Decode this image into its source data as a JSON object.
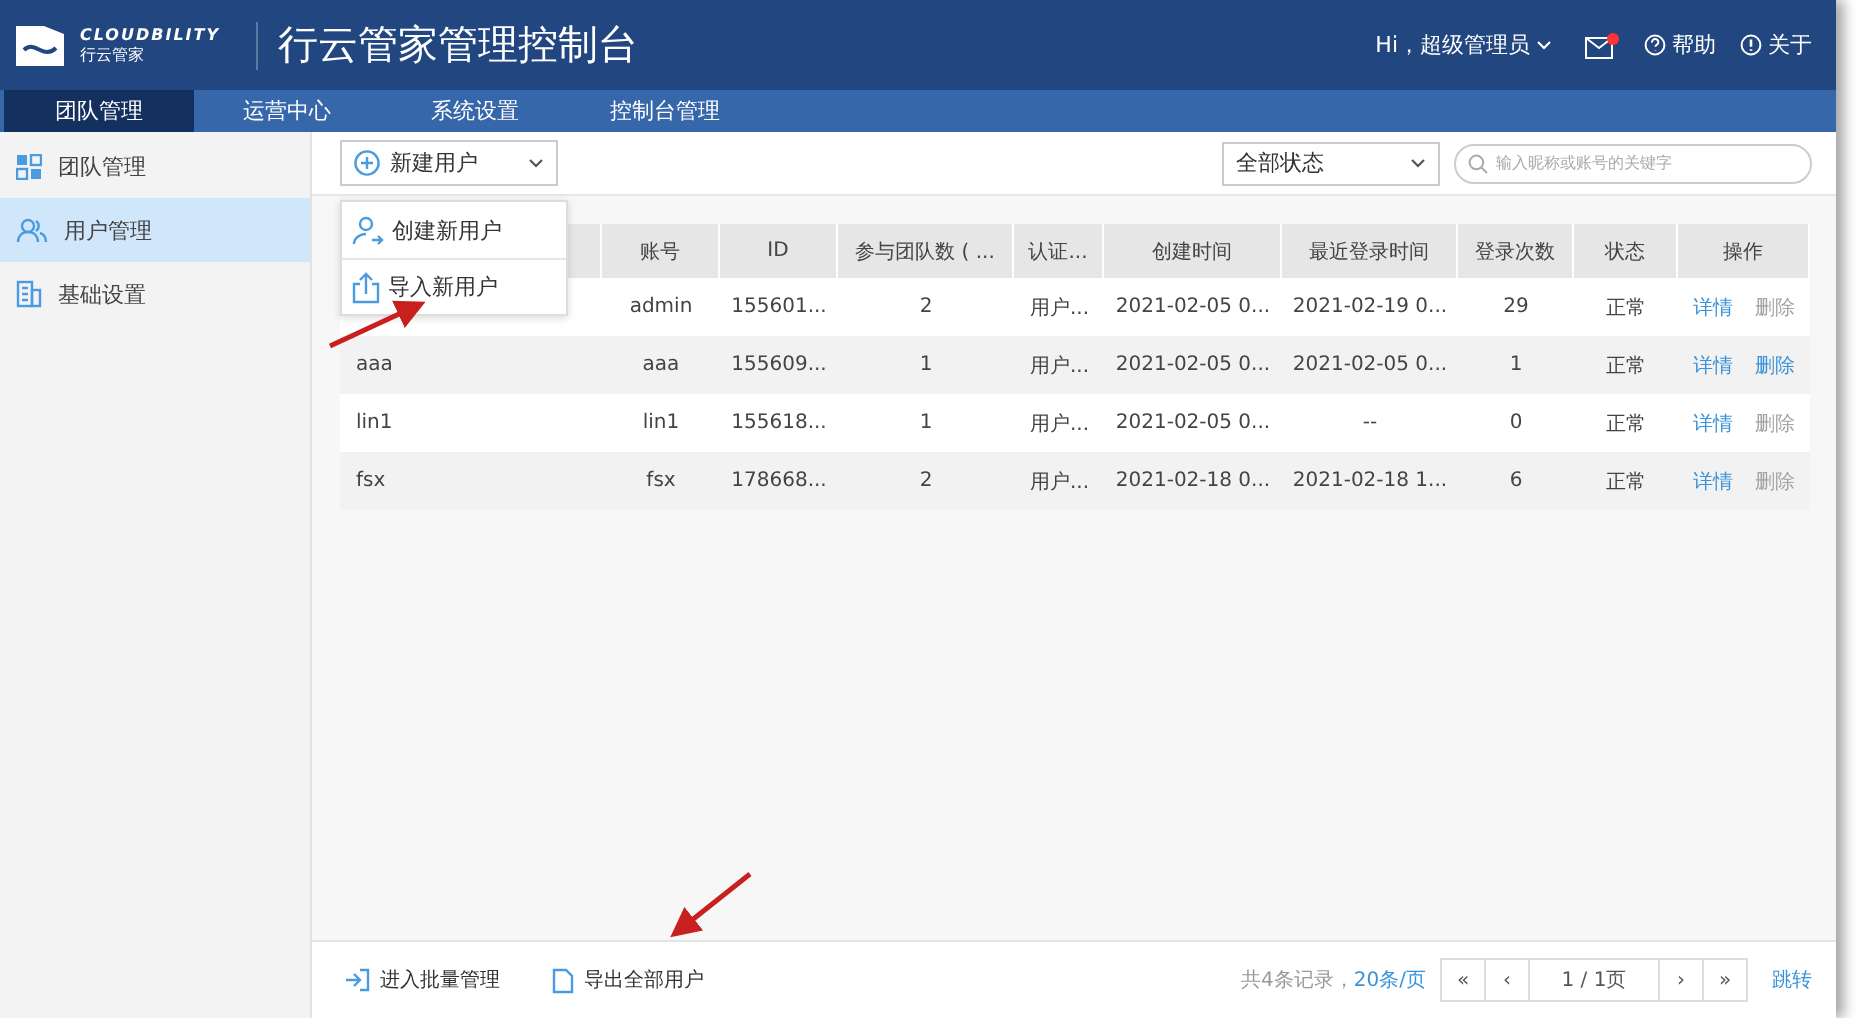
{
  "header": {
    "brand": "CLOUDBILITY",
    "brand_sub": "行云管家",
    "title": "行云管家管理控制台",
    "user": "Hi，超级管理员",
    "mail_unread": true,
    "help": "帮助",
    "about": "关于"
  },
  "nav": [
    {
      "label": "团队管理",
      "selected": true
    },
    {
      "label": "运营中心",
      "selected": false
    },
    {
      "label": "系统设置",
      "selected": false
    },
    {
      "label": "控制台管理",
      "selected": false
    }
  ],
  "sidebar": [
    {
      "label": "团队管理",
      "kind": "grid",
      "selected": false
    },
    {
      "label": "用户管理",
      "kind": "users",
      "selected": true
    },
    {
      "label": "基础设置",
      "kind": "building",
      "selected": false
    }
  ],
  "toolbar": {
    "new_user": "新建用户",
    "menu": [
      {
        "label": "创建新用户",
        "kind": "create"
      },
      {
        "label": "导入新用户",
        "kind": "import"
      }
    ],
    "status": "全部状态",
    "search_placeholder": "输入昵称或账号的关键字"
  },
  "table": {
    "columns": [
      "账号",
      "ID",
      "参与团队数 ( ...",
      "认证...",
      "创建时间",
      "最近登录时间",
      "登录次数",
      "状态",
      "操作"
    ],
    "rows": [
      {
        "account": "admin",
        "id": "155601...",
        "teams": "2",
        "auth": "用户...",
        "created": "2021-02-05 0...",
        "last_login": "2021-02-19 0...",
        "logins": "29",
        "status": "正常",
        "detail": "详情",
        "delete": "删除",
        "delete_disabled": true
      },
      {
        "name": "aaa",
        "account": "aaa",
        "id": "155609...",
        "teams": "1",
        "auth": "用户...",
        "created": "2021-02-05 0...",
        "last_login": "2021-02-05 0...",
        "logins": "1",
        "status": "正常",
        "detail": "详情",
        "delete": "删除",
        "delete_disabled": false
      },
      {
        "name": "lin1",
        "account": "lin1",
        "id": "155618...",
        "teams": "1",
        "auth": "用户...",
        "created": "2021-02-05 0...",
        "last_login": "--",
        "logins": "0",
        "status": "正常",
        "detail": "详情",
        "delete": "删除",
        "delete_disabled": true
      },
      {
        "name": "fsx",
        "account": "fsx",
        "id": "178668...",
        "teams": "2",
        "auth": "用户...",
        "created": "2021-02-18 0...",
        "last_login": "2021-02-18 1...",
        "logins": "6",
        "status": "正常",
        "detail": "详情",
        "delete": "删除",
        "delete_disabled": true
      }
    ]
  },
  "footer": {
    "batch": "进入批量管理",
    "export": "导出全部用户",
    "total": "共4条记录，",
    "per_page": "20条/页",
    "first": "«",
    "prev": "‹",
    "page": "1 / 1页",
    "next": "›",
    "last": "»",
    "jump": "跳转"
  }
}
